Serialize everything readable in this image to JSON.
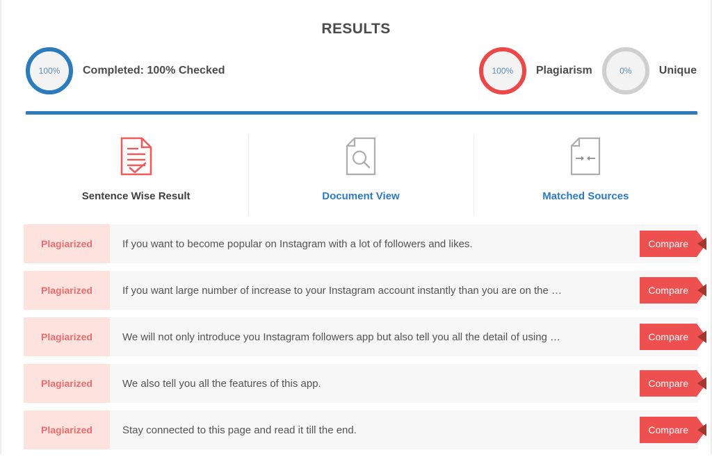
{
  "header": {
    "title": "RESULTS"
  },
  "stats": {
    "completed": {
      "percent": "100%",
      "label": "Completed: 100% Checked",
      "color": "#2b7bbd",
      "icon": "progress-donut-icon"
    },
    "plagiarism": {
      "percent": "100%",
      "label": "Plagiarism",
      "color": "#ed4848",
      "icon": "progress-donut-icon"
    },
    "unique": {
      "percent": "0%",
      "label": "Unique",
      "color": "#cfcfcf",
      "icon": "progress-donut-icon"
    }
  },
  "divider": {
    "color": "#2b7bbd"
  },
  "tabs": [
    {
      "label": "Sentence Wise Result",
      "icon": "document-check-icon",
      "icon_color": "#ef5b5b",
      "label_style": "dark",
      "active": true
    },
    {
      "label": "Document View",
      "icon": "document-search-icon",
      "icon_color": "#a8a8a8",
      "label_style": "link",
      "active": false
    },
    {
      "label": "Matched Sources",
      "icon": "document-compare-icon",
      "icon_color": "#a8a8a8",
      "label_style": "link",
      "active": false
    }
  ],
  "results": {
    "compare_label": "Compare",
    "badge_label": "Plagiarized",
    "rows": [
      {
        "status": "Plagiarized",
        "text": "If you want to become popular on Instagram with a lot of followers and likes.",
        "action": "Compare"
      },
      {
        "status": "Plagiarized",
        "text": "If you want large number of increase to your Instagram account instantly than you are on the …",
        "action": "Compare"
      },
      {
        "status": "Plagiarized",
        "text": "We will not only introduce you Instagram followers app but also tell you all the detail of using …",
        "action": "Compare"
      },
      {
        "status": "Plagiarized",
        "text": "We also tell you all the features of this app.",
        "action": "Compare"
      },
      {
        "status": "Plagiarized",
        "text": "Stay connected to this page and read it till the end.",
        "action": "Compare"
      }
    ]
  }
}
